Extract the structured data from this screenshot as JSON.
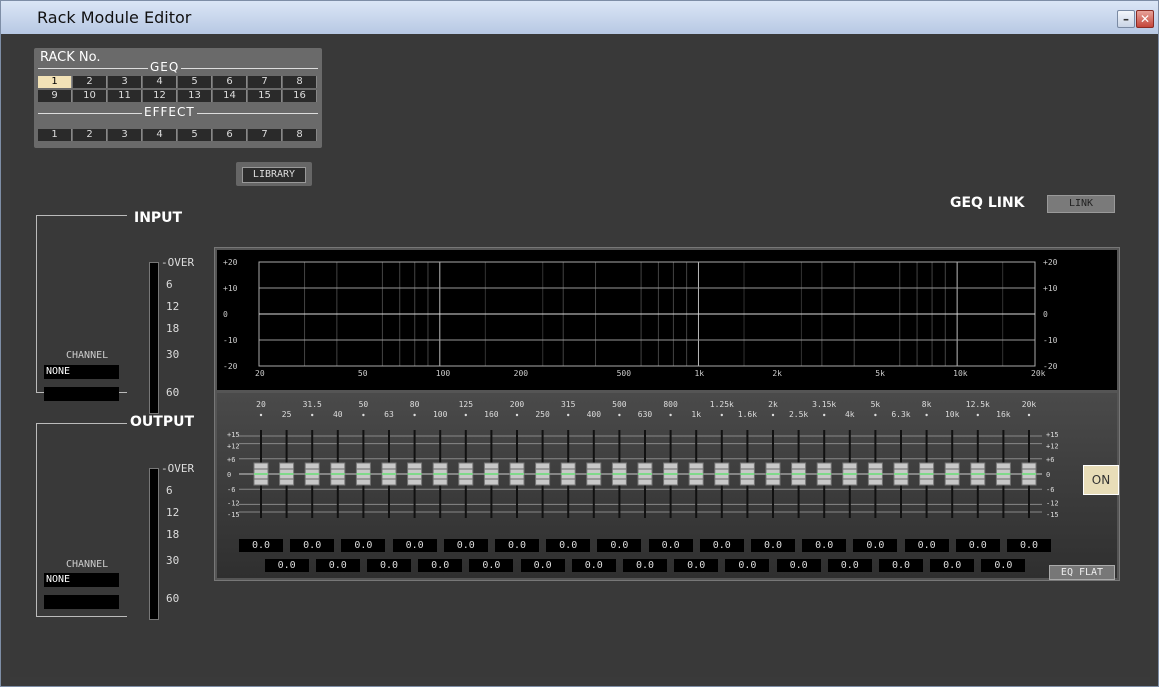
{
  "window": {
    "title": "Rack Module Editor"
  },
  "rack": {
    "label": "RACK No.",
    "geq_label": "GEQ",
    "effect_label": "EFFECT",
    "geq_row1": [
      "1",
      "2",
      "3",
      "4",
      "5",
      "6",
      "7",
      "8"
    ],
    "geq_row2": [
      "9",
      "10",
      "11",
      "12",
      "13",
      "14",
      "15",
      "16"
    ],
    "effect_row": [
      "1",
      "2",
      "3",
      "4",
      "5",
      "6",
      "7",
      "8"
    ],
    "selected": "GEQ 1"
  },
  "library_label": "LIBRARY",
  "input": {
    "label": "INPUT",
    "channel_label": "CHANNEL",
    "channel_value": "NONE"
  },
  "output": {
    "label": "OUTPUT",
    "channel_label": "CHANNEL",
    "channel_value": "NONE"
  },
  "meter_scale": [
    "OVER",
    "6",
    "12",
    "18",
    "30",
    "60"
  ],
  "geq_link": {
    "label": "GEQ LINK",
    "button": "LINK"
  },
  "graph": {
    "y_ticks": [
      "+20",
      "+10",
      "0",
      "-10",
      "-20"
    ],
    "x_ticks": [
      "20",
      "50",
      "100",
      "200",
      "500",
      "1k",
      "2k",
      "5k",
      "10k",
      "20k"
    ]
  },
  "bands": {
    "freq_top": [
      "20",
      "31.5",
      "50",
      "80",
      "125",
      "200",
      "315",
      "500",
      "800",
      "1.25k",
      "2k",
      "3.15k",
      "5k",
      "8k",
      "12.5k",
      "20k"
    ],
    "freq_bottom": [
      "25",
      "40",
      "63",
      "100",
      "160",
      "250",
      "400",
      "630",
      "1k",
      "1.6k",
      "2.5k",
      "4k",
      "6.3k",
      "10k",
      "16k"
    ],
    "gains": [
      "0.0",
      "0.0",
      "0.0",
      "0.0",
      "0.0",
      "0.0",
      "0.0",
      "0.0",
      "0.0",
      "0.0",
      "0.0",
      "0.0",
      "0.0",
      "0.0",
      "0.0",
      "0.0",
      "0.0",
      "0.0",
      "0.0",
      "0.0",
      "0.0",
      "0.0",
      "0.0",
      "0.0",
      "0.0",
      "0.0",
      "0.0",
      "0.0",
      "0.0",
      "0.0",
      "0.0"
    ],
    "scale": [
      "+15",
      "+12",
      "+6",
      "0",
      "-6",
      "-12",
      "-15"
    ]
  },
  "on_label": "ON",
  "eqflat_label": "EQ FLAT"
}
